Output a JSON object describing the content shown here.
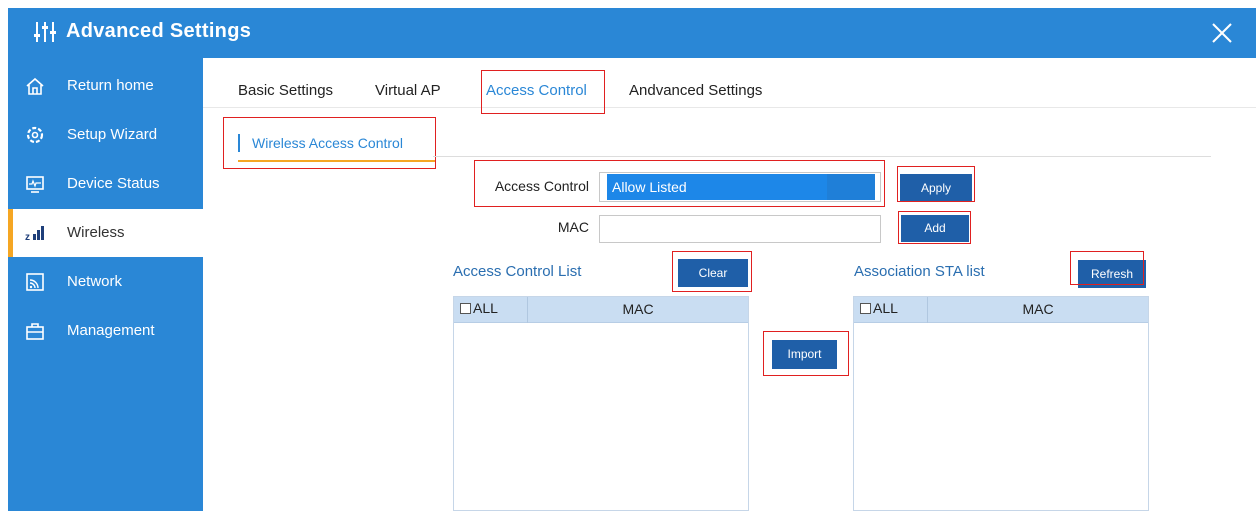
{
  "window": {
    "title": "Advanced Settings"
  },
  "sidebar": {
    "items": [
      {
        "label": "Return home",
        "icon": "home-icon"
      },
      {
        "label": "Setup Wizard",
        "icon": "wizard-gear-icon"
      },
      {
        "label": "Device Status",
        "icon": "monitor-icon"
      },
      {
        "label": "Wireless",
        "icon": "signal-bars-icon"
      },
      {
        "label": "Network",
        "icon": "network-icon"
      },
      {
        "label": "Management",
        "icon": "briefcase-icon"
      }
    ],
    "active": "Wireless"
  },
  "tabs": [
    {
      "label": "Basic Settings"
    },
    {
      "label": "Virtual AP"
    },
    {
      "label": "Access Control"
    },
    {
      "label": "Andvanced Settings"
    }
  ],
  "active_tab": "Access Control",
  "subtab": {
    "label": "Wireless Access Control"
  },
  "form": {
    "access_control_label": "Access Control",
    "access_control_value": "Allow Listed",
    "mac_label": "MAC",
    "mac_value": "",
    "apply_label": "Apply",
    "add_label": "Add"
  },
  "acl": {
    "title": "Access Control List",
    "clear_label": "Clear",
    "col_all": "ALL",
    "col_mac": "MAC",
    "rows": []
  },
  "import_label": "Import",
  "sta": {
    "title": "Association STA list",
    "refresh_label": "Refresh",
    "col_all": "ALL",
    "col_mac": "MAC",
    "rows": []
  },
  "colors": {
    "brand_blue": "#2a87d6",
    "button_blue": "#1f5fa8",
    "active_accent": "#f5a623",
    "highlight_red": "#e02020"
  }
}
